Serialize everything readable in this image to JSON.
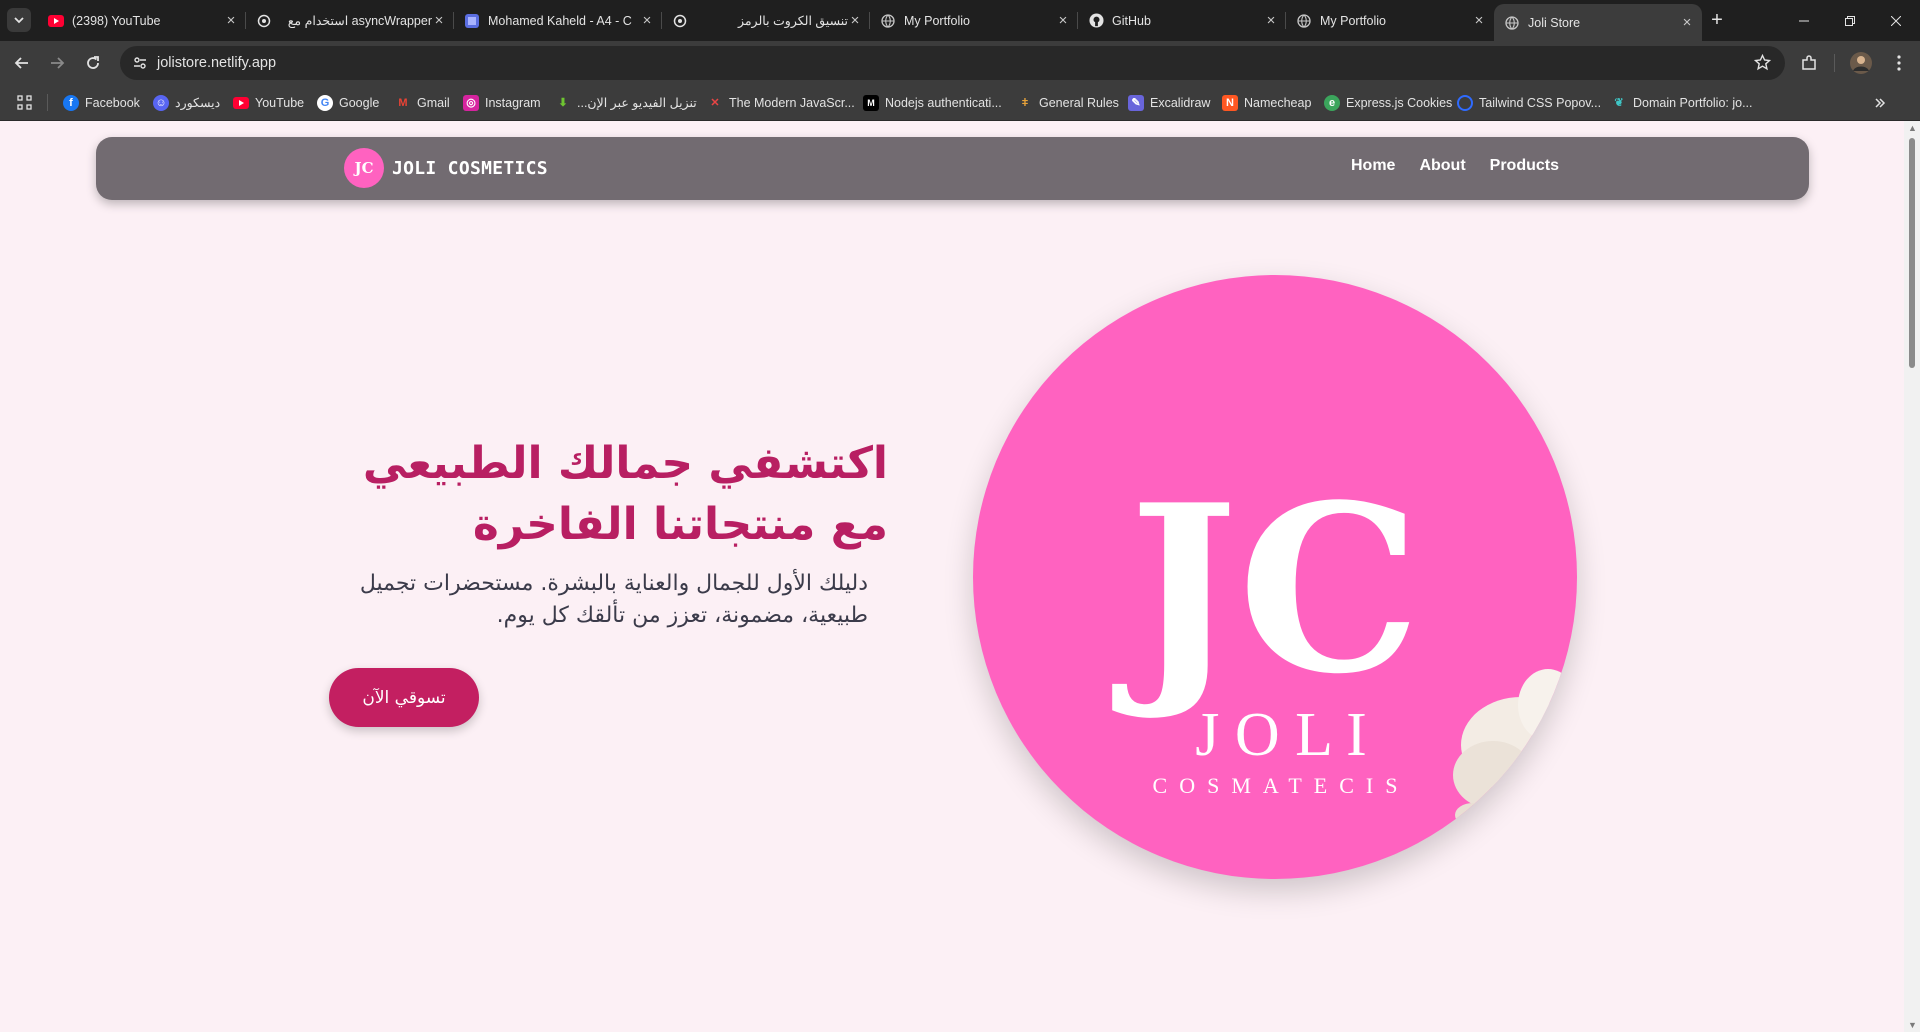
{
  "browser": {
    "tabs": [
      {
        "title": "(2398) YouTube",
        "icon": "youtube-icon"
      },
      {
        "title": "asyncWrapper استخدام مع",
        "icon": "chatgpt-icon"
      },
      {
        "title": "Mohamed Kaheld - A4 - C",
        "icon": "document-icon"
      },
      {
        "title": "تنسيق الكروت بالرمز",
        "icon": "chatgpt-icon"
      },
      {
        "title": "My Portfolio",
        "icon": "globe-icon"
      },
      {
        "title": "GitHub",
        "icon": "github-icon"
      },
      {
        "title": "My Portfolio",
        "icon": "globe-icon"
      },
      {
        "title": "Joli Store",
        "icon": "globe-icon",
        "active": true
      }
    ],
    "url": "jolistore.netlify.app",
    "bookmarks": [
      {
        "label": "Facebook",
        "icon": "facebook-icon"
      },
      {
        "label": "ديسكورد",
        "icon": "discord-icon"
      },
      {
        "label": "YouTube",
        "icon": "youtube-icon"
      },
      {
        "label": "Google",
        "icon": "google-icon"
      },
      {
        "label": "Gmail",
        "icon": "gmail-icon"
      },
      {
        "label": "Instagram",
        "icon": "instagram-icon"
      },
      {
        "label": "تنزيل الفيديو عبر الإن...",
        "icon": "download-icon"
      },
      {
        "label": "The Modern JavaScr...",
        "icon": "javascript-icon"
      },
      {
        "label": "Nodejs authenticati...",
        "icon": "medium-icon"
      },
      {
        "label": "General Rules",
        "icon": "rules-icon"
      },
      {
        "label": "Excalidraw",
        "icon": "excalidraw-icon"
      },
      {
        "label": "Namecheap",
        "icon": "namecheap-icon"
      },
      {
        "label": "Express.js Cookies",
        "icon": "express-icon"
      },
      {
        "label": "Tailwind CSS Popov...",
        "icon": "tailwind-icon"
      },
      {
        "label": "Domain Portfolio: jo...",
        "icon": "domain-icon"
      }
    ]
  },
  "site": {
    "brand": {
      "logo_text": "JC",
      "name": "JOLI COSMETICS"
    },
    "nav": {
      "home": "Home",
      "about": "About",
      "products": "Products"
    },
    "hero": {
      "title_line1": "اكتشفي جمالك الطبيعي",
      "title_line2": "مع منتجاتنا الفاخرة",
      "subtitle": "دليلك الأول للجمال والعناية بالبشرة. مستحضرات تجميل طبيعية، مضمونة، تعزز من تألقك كل يوم.",
      "cta": "تسوقي الآن",
      "image": {
        "monogram": "JC",
        "wordmark": "J O L I",
        "tagline": "COSMATECIS"
      }
    }
  },
  "colors": {
    "page_bg": "#fcf0f5",
    "navbar_bg": "#726b71",
    "accent": "#c31f61",
    "title": "#b81f62",
    "logo_pink": "#ff62c0"
  }
}
